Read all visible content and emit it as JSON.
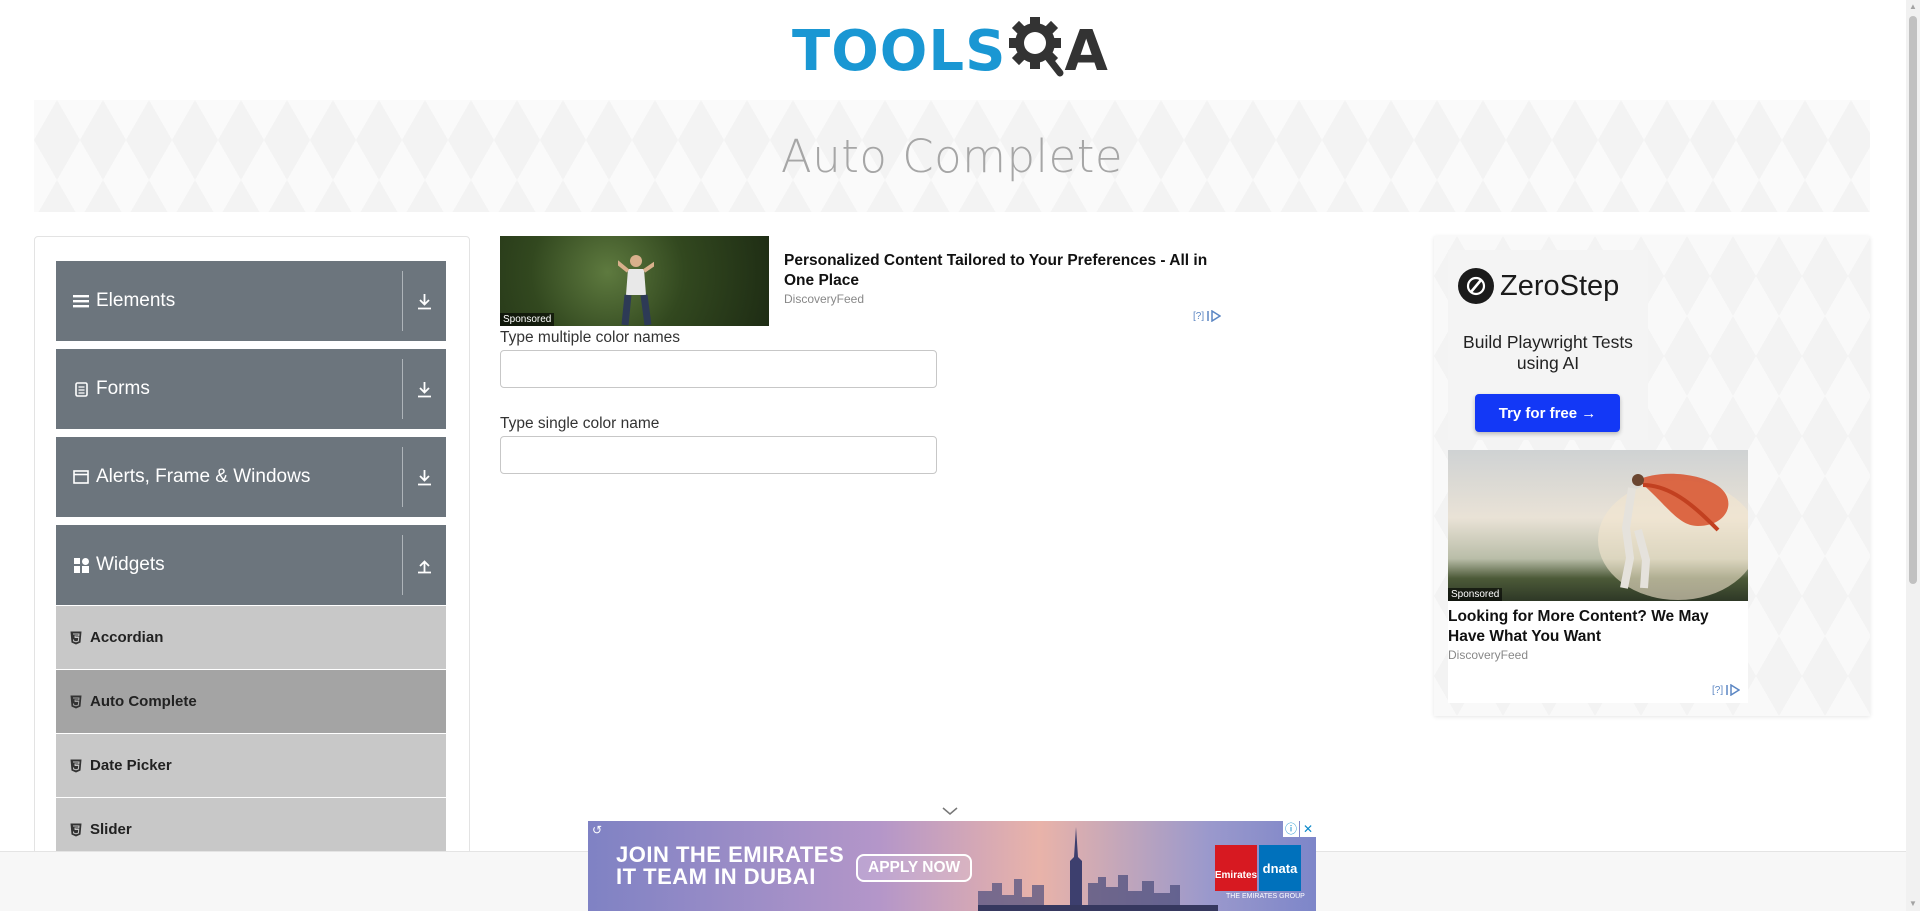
{
  "header": {
    "logo_tools": "TOOLS",
    "logo_qa": "A",
    "page_title": "Auto Complete"
  },
  "nav": {
    "groups": [
      {
        "label": "Elements",
        "icon": "hamburger-icon",
        "expanded": false
      },
      {
        "label": "Forms",
        "icon": "document-icon",
        "expanded": false
      },
      {
        "label": "Alerts, Frame & Windows",
        "icon": "window-icon",
        "expanded": false
      },
      {
        "label": "Widgets",
        "icon": "grid-icon",
        "expanded": true
      }
    ],
    "widget_items": [
      {
        "label": "Accordian",
        "active": false
      },
      {
        "label": "Auto Complete",
        "active": true
      },
      {
        "label": "Date Picker",
        "active": false
      },
      {
        "label": "Slider",
        "active": false
      }
    ]
  },
  "top_ad": {
    "sponsored": "Sponsored",
    "title": "Personalized Content Tailored to Your Preferences - All in One Place",
    "source": "DiscoveryFeed",
    "choices": "[?]"
  },
  "form": {
    "multi_label": "Type multiple color names",
    "multi_value": "",
    "single_label": "Type single color name",
    "single_value": ""
  },
  "right_ad": {
    "brand": "ZeroStep",
    "subtitle": "Build Playwright Tests using AI",
    "cta": "Try for free →",
    "sponsored": "Sponsored",
    "title": "Looking for More Content? We May Have What You Want",
    "source": "DiscoveryFeed",
    "choices": "[?]"
  },
  "bottom_ad": {
    "headline_1": "JOIN THE EMIRATES",
    "headline_2": "IT TEAM IN DUBAI",
    "cta": "APPLY NOW",
    "logo_emirates": "Emirates",
    "logo_dnata": "dnata",
    "group": "THE EMIRATES GROUP"
  },
  "colors": {
    "nav_header": "#6c757d",
    "nav_item": "#c8c8c8",
    "nav_item_active": "#a4a4a4",
    "brand_blue": "#1a97d3",
    "cta_blue": "#1338f6"
  }
}
